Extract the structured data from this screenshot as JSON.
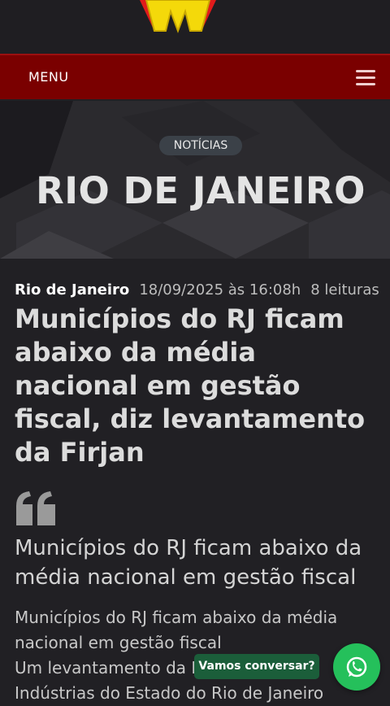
{
  "header": {
    "logo_icon": "brand-logo",
    "menu_label": "MENU",
    "menu_icon": "hamburger-icon",
    "brand_color": "#7a0000"
  },
  "hero": {
    "badge": "NOTÍCIAS",
    "title": "RIO DE JANEIRO"
  },
  "article": {
    "category": "Rio de Janeiro",
    "date": "18/09/2025 às 16:08h",
    "reads": "8 leituras",
    "headline": "Municípios do RJ ficam abaixo da média nacional em gestão fiscal, diz levantamento da Firjan",
    "quote_icon": "quote-icon",
    "subtitle": "Municípios do RJ ficam abaixo da média nacional em gestão fiscal",
    "body_lines": [
      "Municípios do RJ ficam abaixo da média",
      "nacional em gestão fiscal",
      "Um levantamento da Federação das",
      "Indústrias do Estado do Rio de Janeiro"
    ]
  },
  "chat": {
    "prompt": "Vamos conversar?",
    "icon": "whatsapp-icon",
    "color": "#25c05b"
  }
}
